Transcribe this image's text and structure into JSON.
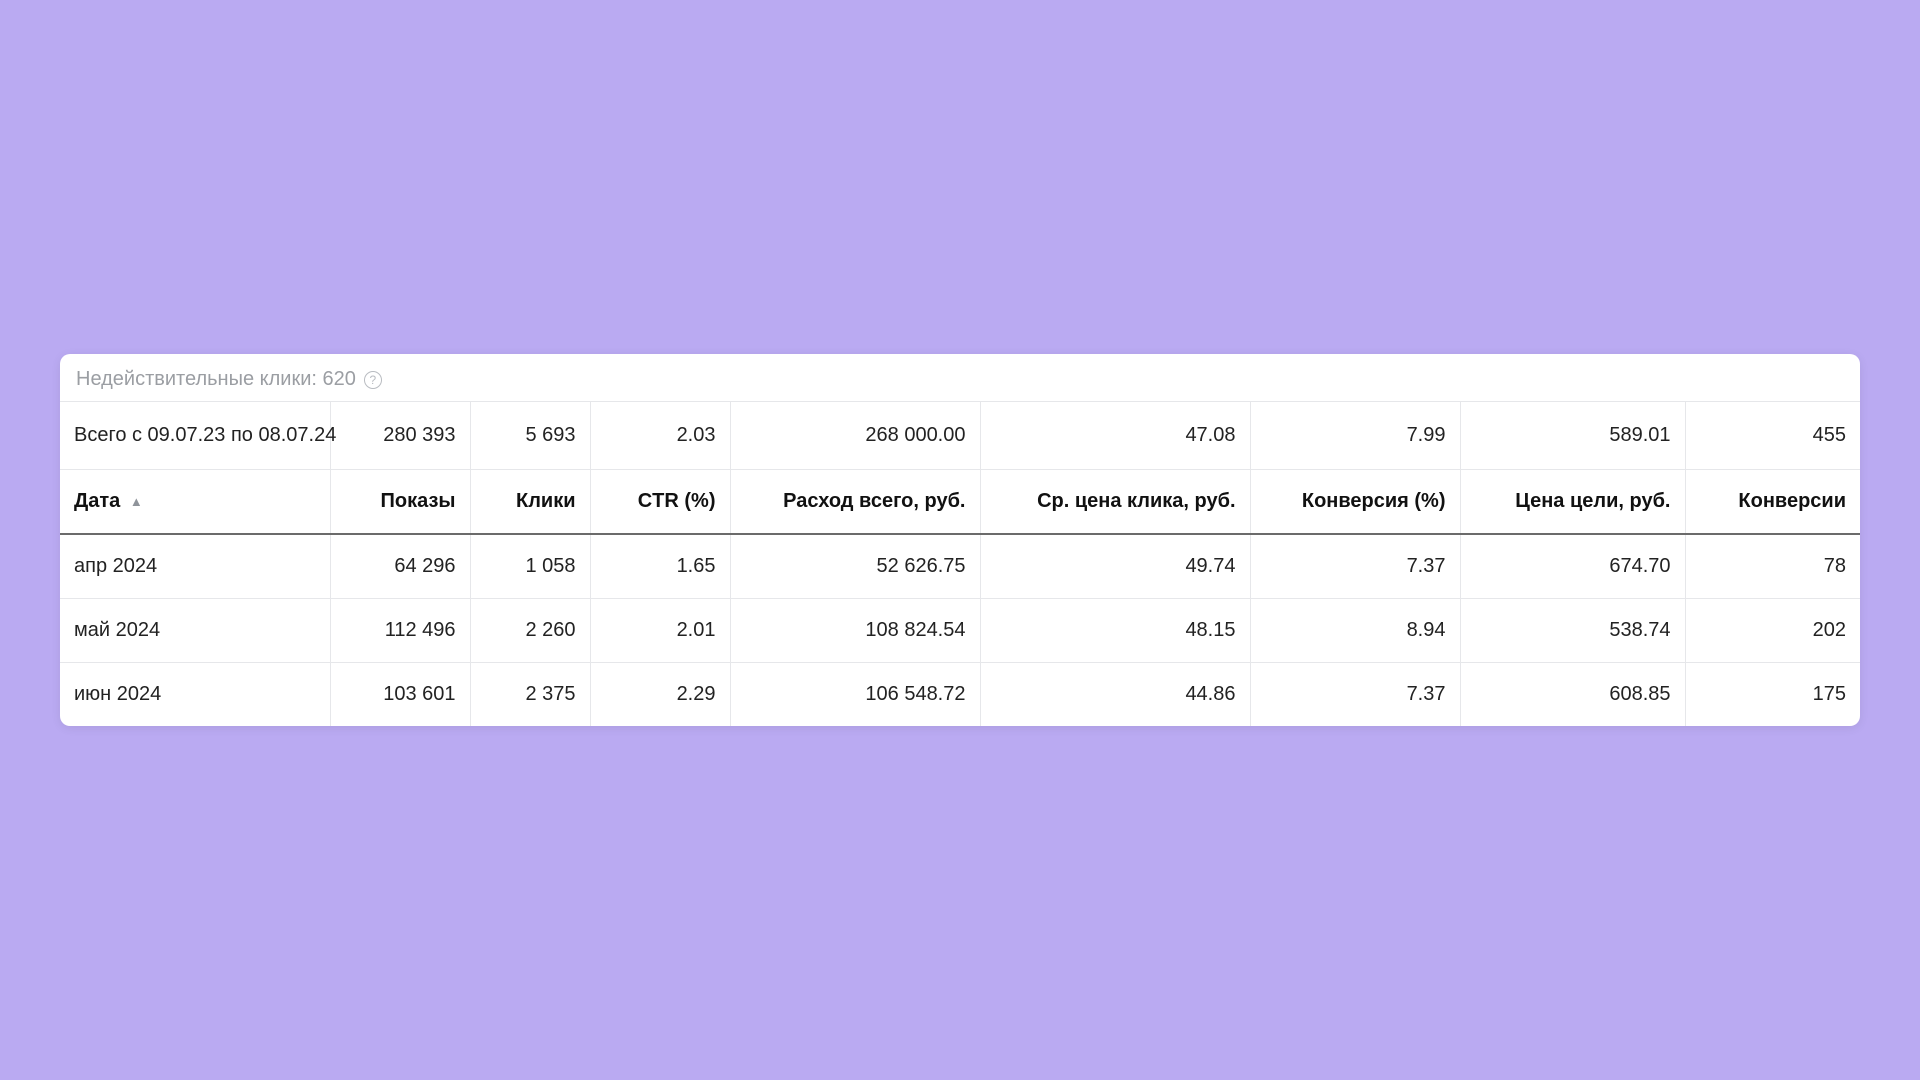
{
  "info": {
    "invalid_clicks_label": "Недействительные клики: 620"
  },
  "totals": {
    "label": "Всего с 09.07.23 по 08.07.24",
    "impressions": "280 393",
    "clicks": "5 693",
    "ctr": "2.03",
    "spend": "268 000.00",
    "cpc": "47.08",
    "conversion_pct": "7.99",
    "goal_price": "589.01",
    "conversions": "455"
  },
  "columns": {
    "date": "Дата",
    "impressions": "Показы",
    "clicks": "Клики",
    "ctr": "CTR (%)",
    "spend": "Расход всего, руб.",
    "cpc": "Ср. цена клика, руб.",
    "conversion_pct": "Конверсия (%)",
    "goal_price": "Цена цели, руб.",
    "conversions": "Конверсии"
  },
  "rows": [
    {
      "date": "апр 2024",
      "impressions": "64 296",
      "clicks": "1 058",
      "ctr": "1.65",
      "spend": "52 626.75",
      "cpc": "49.74",
      "conversion_pct": "7.37",
      "goal_price": "674.70",
      "conversions": "78"
    },
    {
      "date": "май 2024",
      "impressions": "112 496",
      "clicks": "2 260",
      "ctr": "2.01",
      "spend": "108 824.54",
      "cpc": "48.15",
      "conversion_pct": "8.94",
      "goal_price": "538.74",
      "conversions": "202"
    },
    {
      "date": "июн 2024",
      "impressions": "103 601",
      "clicks": "2 375",
      "ctr": "2.29",
      "spend": "106 548.72",
      "cpc": "44.86",
      "conversion_pct": "7.37",
      "goal_price": "608.85",
      "conversions": "175"
    }
  ]
}
